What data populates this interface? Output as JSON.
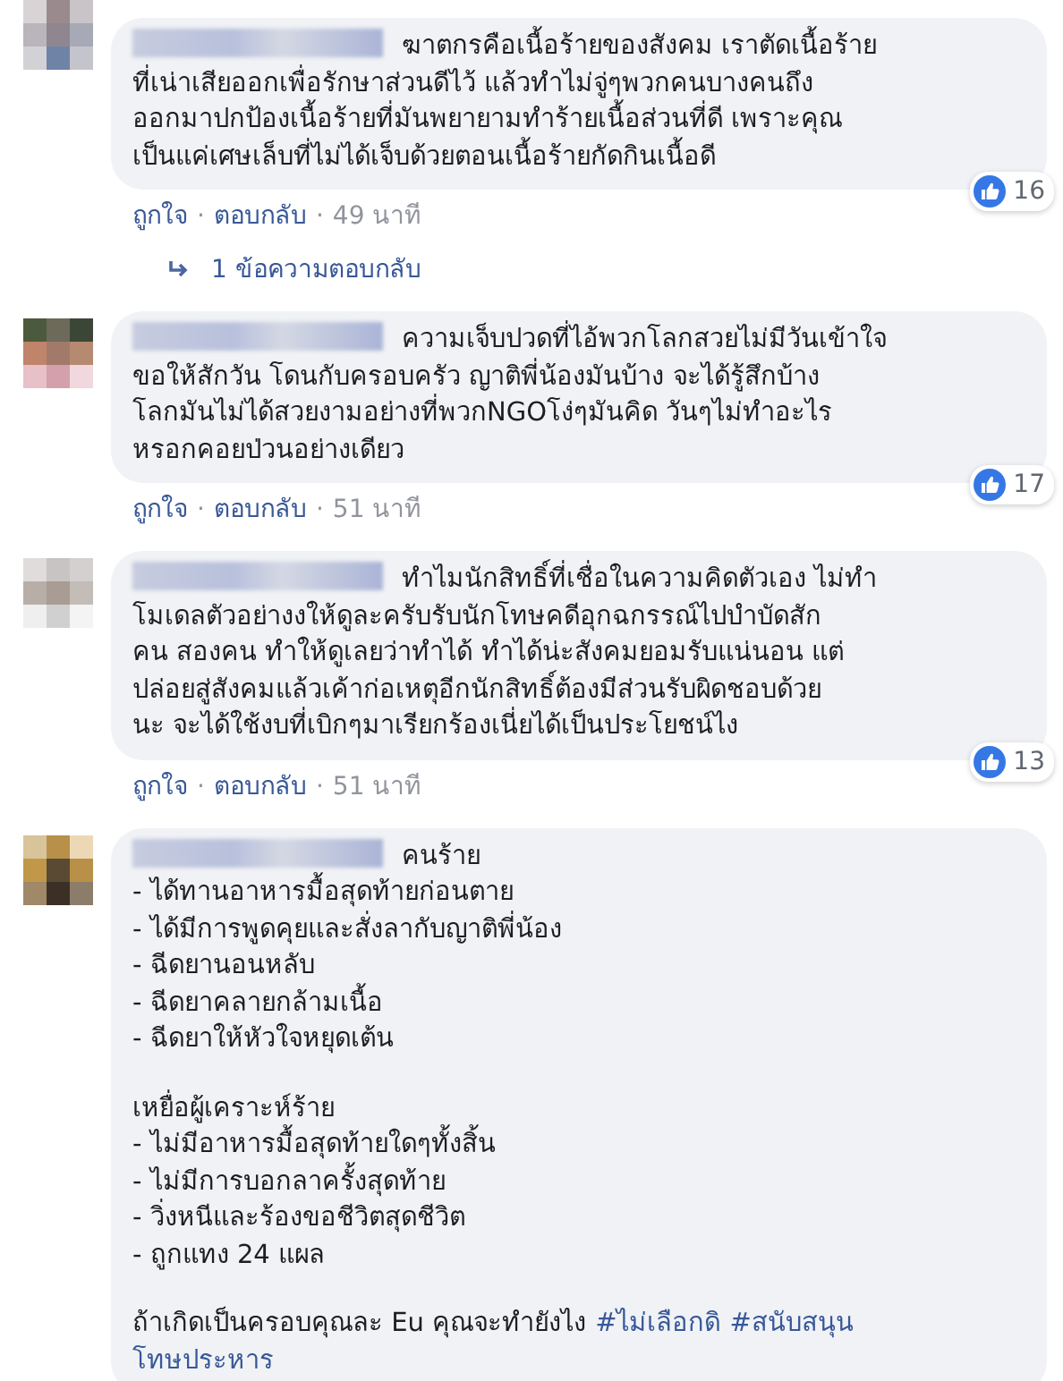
{
  "comments": [
    {
      "paragraphs": [
        [
          [
            {
              "kind": "text",
              "text": "ฆาตกรคือเนื้อร้ายของสังคม เราตัดเนื้อร้าย"
            }
          ],
          [
            {
              "kind": "text",
              "text": "ที่เน่าเสียออกเพื่อรักษาส่วนดีไว้ แล้วทำไม่จู่ๆพวกคนบางคนถึง"
            }
          ],
          [
            {
              "kind": "text",
              "text": "ออกมาปกป้องเนื้อร้ายที่มันพยายามทำร้ายเนื้อส่วนที่ดี เพราะคุณ"
            }
          ],
          [
            {
              "kind": "text",
              "text": "เป็นแค่เศษเล็บที่ไม่ได้เจ็บด้วยตอนเนื้อร้ายกัดกินเนื้อดี"
            }
          ]
        ]
      ],
      "likes": "16",
      "actions": {
        "like": "ถูกใจ",
        "separator": "·",
        "reply": "ตอบกลับ",
        "time": "49 นาที"
      },
      "replies_link": "1 ข้อความตอบกลับ"
    },
    {
      "paragraphs": [
        [
          [
            {
              "kind": "text",
              "text": "ความเจ็บปวดที่ไอ้พวกโลกสวยไม่มีวันเข้าใจ"
            }
          ],
          [
            {
              "kind": "text",
              "text": "ขอให้สักวัน โดนกับครอบครัว ญาติพี่น้องมันบ้าง จะได้รู้สึกบ้าง"
            }
          ],
          [
            {
              "kind": "text",
              "text": "โลกมันไม่ได้สวยงามอย่างที่พวกNGOโง่ๆมันคิด วันๆไม่ทำอะไร"
            }
          ],
          [
            {
              "kind": "text",
              "text": "หรอกคอยป่วนอย่างเดียว"
            }
          ]
        ]
      ],
      "likes": "17",
      "actions": {
        "like": "ถูกใจ",
        "separator": "·",
        "reply": "ตอบกลับ",
        "time": "51 นาที"
      }
    },
    {
      "paragraphs": [
        [
          [
            {
              "kind": "text",
              "text": "ทำไมนักสิทธิ์ที่เชื่อในความคิดตัวเอง ไม่ทำ"
            }
          ],
          [
            {
              "kind": "text",
              "text": "โมเดลตัวอย่างงให้ดูละครับรับนักโทษคดีอุกฉกรรณ์ไปบำบัดสัก"
            }
          ],
          [
            {
              "kind": "text",
              "text": "คน สองคน ทำให้ดูเลยว่าทำได้ ทำได้น่ะสังคมยอมรับแน่นอน แต่"
            }
          ],
          [
            {
              "kind": "text",
              "text": "ปล่อยสู่สังคมแล้วเค้าก่อเหตุอีกนักสิทธิ์ต้องมีส่วนรับผิดชอบด้วย"
            }
          ],
          [
            {
              "kind": "text",
              "text": "นะ จะได้ใช้งบที่เบิกๆมาเรียกร้องเนี่ยได้เป็นประโยชน์ไง"
            }
          ]
        ]
      ],
      "likes": "13",
      "actions": {
        "like": "ถูกใจ",
        "separator": "·",
        "reply": "ตอบกลับ",
        "time": "51 นาที"
      }
    },
    {
      "paragraphs": [
        [
          [
            {
              "kind": "text",
              "text": "คนร้าย"
            }
          ],
          [
            {
              "kind": "text",
              "text": "- ได้ทานอาหารมื้อสุดท้ายก่อนตาย"
            }
          ],
          [
            {
              "kind": "text",
              "text": "- ได้มีการพูดคุยและสั่งลากับญาติพี่น้อง"
            }
          ],
          [
            {
              "kind": "text",
              "text": "- ฉีดยานอนหลับ"
            }
          ],
          [
            {
              "kind": "text",
              "text": "- ฉีดยาคลายกล้ามเนื้อ"
            }
          ],
          [
            {
              "kind": "text",
              "text": "- ฉีดยาให้หัวใจหยุดเต้น"
            }
          ]
        ],
        [
          [
            {
              "kind": "text",
              "text": "เหยื่อผู้เคราะห์ร้าย"
            }
          ],
          [
            {
              "kind": "text",
              "text": "- ไม่มีอาหารมื้อสุดท้ายใดๆทั้งสิ้น"
            }
          ],
          [
            {
              "kind": "text",
              "text": "- ไม่มีการบอกลาครั้งสุดท้าย"
            }
          ],
          [
            {
              "kind": "text",
              "text": "- วิ่งหนีและร้องขอชีวิตสุดชีวิต"
            }
          ],
          [
            {
              "kind": "text",
              "text": "- ถูกแทง 24 แผล"
            }
          ]
        ],
        [
          [
            {
              "kind": "text",
              "text": "ถ้าเกิดเป็นครอบคุณละ Eu คุณจะทำยังไง"
            },
            {
              "kind": "hashtag",
              "text": "#ไม่เลือกดิ"
            },
            {
              "kind": "hashtag",
              "text": "#สนับสนุน"
            }
          ],
          [
            {
              "kind": "hashtag",
              "text": "โทษประหาร"
            }
          ]
        ]
      ]
    }
  ]
}
